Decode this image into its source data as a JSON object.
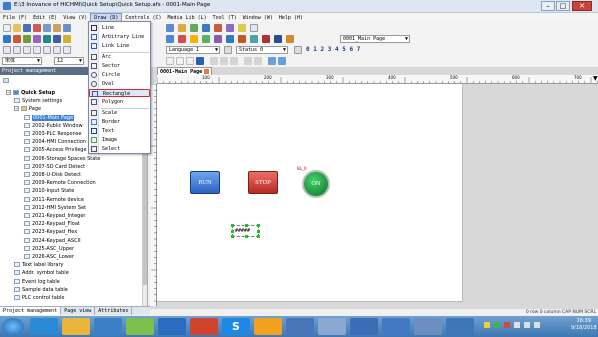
{
  "window": {
    "title": "E:\\3 Inovance of HICHMI\\Quick Setup\\Quick Setup.afs - 0001-Main Page"
  },
  "menubar": [
    "File (F)",
    "Edit (E)",
    "View (V)",
    "Draw (D)",
    "Controls (C)",
    "Media Lib (L)",
    "Tool (T)",
    "Window (W)",
    "Help (H)"
  ],
  "draw_menu": {
    "items": [
      {
        "label": "Line",
        "icon": "line-icon"
      },
      {
        "label": "Arbitrary Line",
        "icon": "arbitrary-line-icon"
      },
      {
        "label": "Link Line",
        "icon": "link-line-icon"
      },
      {
        "label": "Arc",
        "icon": "arc-icon"
      },
      {
        "label": "Sector",
        "icon": "sector-icon"
      },
      {
        "label": "Circle",
        "icon": "circle-icon"
      },
      {
        "label": "Oval",
        "icon": "oval-icon"
      },
      {
        "label": "Rectangle",
        "icon": "rectangle-icon"
      },
      {
        "label": "Polygon",
        "icon": "polygon-icon"
      },
      {
        "label": "Scale",
        "icon": "scale-icon"
      },
      {
        "label": "Border",
        "icon": "border-icon"
      },
      {
        "label": "Text",
        "icon": "text-icon"
      },
      {
        "label": "Image",
        "icon": "image-icon"
      },
      {
        "label": "Select",
        "icon": "select-icon"
      }
    ],
    "highlighted": "Rectangle"
  },
  "toolbar": {
    "page_select": "0001_Main Page",
    "language_select": "Language 1",
    "status_select": "Status 0",
    "font_name": "宋体",
    "font_size": "12",
    "layer_digits": [
      "0",
      "1",
      "2",
      "3",
      "4",
      "5",
      "6",
      "7"
    ]
  },
  "project_panel": {
    "header": "Project management",
    "tree": [
      {
        "label": "Quick Setup",
        "level": 0,
        "type": "root"
      },
      {
        "label": "System settings",
        "level": 1
      },
      {
        "label": "Page",
        "level": 1,
        "type": "folder"
      },
      {
        "label": "0001-Main Page",
        "level": 2,
        "selected": true
      },
      {
        "label": "2002-Public Window",
        "level": 2
      },
      {
        "label": "2003-PLC Response",
        "level": 2
      },
      {
        "label": "2004-HMI Connection",
        "level": 2
      },
      {
        "label": "2005-Access Privilege",
        "level": 2
      },
      {
        "label": "2006-Storage Spaces State",
        "level": 2
      },
      {
        "label": "2007-SD Card Detect",
        "level": 2
      },
      {
        "label": "2008-U-Disk Detect",
        "level": 2
      },
      {
        "label": "2009-Remote Connection",
        "level": 2
      },
      {
        "label": "2010-Input State",
        "level": 2
      },
      {
        "label": "2011-Remote device",
        "level": 2
      },
      {
        "label": "2012-HMI System Set",
        "level": 2
      },
      {
        "label": "2021-Keypad_Integer",
        "level": 2
      },
      {
        "label": "2022-Keypad_Float",
        "level": 2
      },
      {
        "label": "2023-Keypad_Hex",
        "level": 2
      },
      {
        "label": "2024-Keypad_ASCII",
        "level": 2
      },
      {
        "label": "2025-ASC_Upper",
        "level": 2
      },
      {
        "label": "2026-ASC_Lower",
        "level": 2
      },
      {
        "label": "Text label library",
        "level": 1
      },
      {
        "label": "Addr. symbol table",
        "level": 1
      },
      {
        "label": "Event log table",
        "level": 1
      },
      {
        "label": "Sample data table",
        "level": 1
      },
      {
        "label": "PLC control table",
        "level": 1
      }
    ],
    "bottom_tabs": [
      "Project management",
      "Page view",
      "Attributes"
    ]
  },
  "document": {
    "tab_title": "0001-Main Page",
    "ruler_ticks": [
      "100",
      "200",
      "300",
      "400",
      "500",
      "600",
      "700"
    ],
    "buttons": [
      {
        "label": "RUN",
        "color": "#2f6fd0"
      },
      {
        "label": "STOP",
        "color": "#c3332b"
      },
      {
        "label": "ON",
        "color": "#1f9b3a"
      }
    ],
    "lamp_caption": "BL_0",
    "numeric_display": "#####"
  },
  "statusbar": {
    "text": "0 row 0 column CAP NUM SCRL"
  },
  "taskbar": {
    "time": "16:39",
    "date": "9/18/2018"
  }
}
